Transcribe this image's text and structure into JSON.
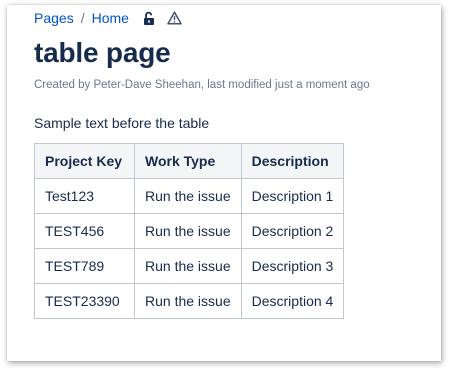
{
  "breadcrumb": {
    "items": [
      "Pages",
      "Home"
    ],
    "separator": "/",
    "icons": [
      "unlock-icon",
      "warning-icon"
    ]
  },
  "page": {
    "title": "table page",
    "byline": {
      "prefix": "Created by ",
      "author": "Peter-Dave Sheehan",
      "middle": ", last modified ",
      "modified": "just a moment ago"
    },
    "intro_text": "Sample text before the table"
  },
  "table": {
    "headers": [
      "Project Key",
      "Work Type",
      "Description"
    ],
    "rows": [
      [
        "Test123",
        "Run the issue",
        "Description 1"
      ],
      [
        "TEST456",
        "Run the issue",
        "Description 2"
      ],
      [
        "TEST789",
        "Run the issue",
        "Description 3"
      ],
      [
        "TEST23390",
        "Run the issue",
        "Description 4"
      ]
    ]
  },
  "colors": {
    "link": "#0052cc",
    "text": "#172b4d",
    "muted": "#6b778c",
    "header_bg": "#f4f5f7",
    "border": "#c1c7d0"
  }
}
